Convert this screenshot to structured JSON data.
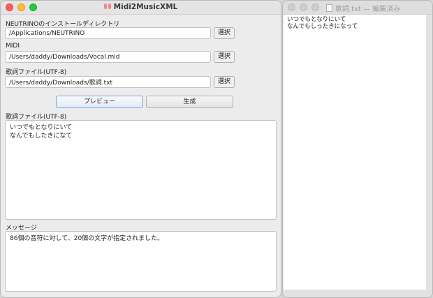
{
  "main_window": {
    "title": "Midi2MusicXML",
    "neutrino_label": "NEUTRINOのインストールディレクトリ",
    "neutrino_path": "/Applications/NEUTRINO",
    "midi_label": "MIDI",
    "midi_path": "/Users/daddy/Downloads/Vocal.mid",
    "lyrics_file_label": "歌詞ファイル(UTF-8)",
    "lyrics_path": "/Users/daddy/Downloads/歌詞.txt",
    "select_label": "選択",
    "preview_button": "プレビュー",
    "generate_button": "生成",
    "lyrics_preview_label": "歌詞ファイル(UTF-8)",
    "lyrics_preview_text": "いつでもとなりにいて\nなんでもしたきになて",
    "message_label": "メッセージ",
    "message_text": "86個の音符に対して、20個の文字が指定されました。"
  },
  "side_window": {
    "title": "歌詞.txt — 編集済み",
    "content": "いつでもとなりにいて\nなんでもしったきになって"
  },
  "colors": {
    "close": "#fe5f57",
    "minimize": "#febc2e",
    "zoom": "#28c840",
    "focus_ring": "#74a6dc"
  }
}
